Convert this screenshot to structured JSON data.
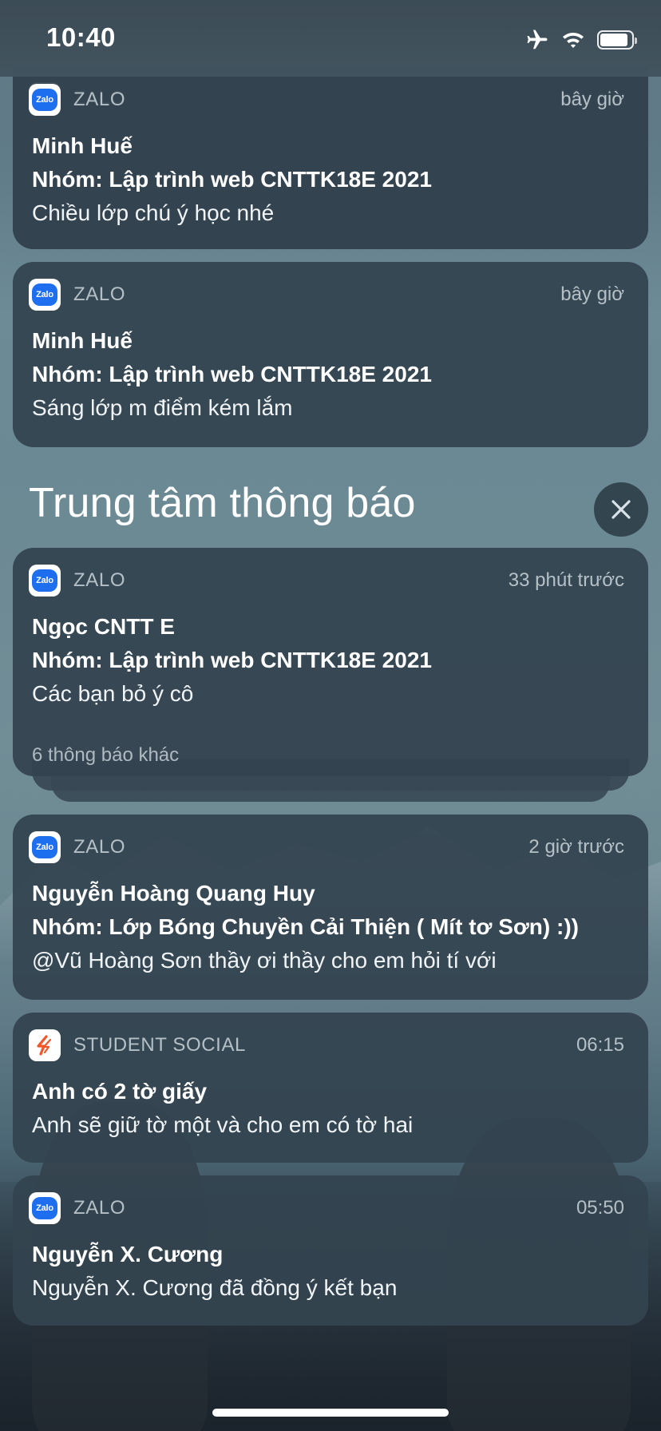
{
  "status_bar": {
    "time": "10:40",
    "icons": [
      "airplane-icon",
      "wifi-icon",
      "battery-icon"
    ],
    "battery_level": 0.9
  },
  "section": {
    "title": "Trung tâm thông báo",
    "close_icon": "close-icon"
  },
  "notifications": [
    {
      "app": "ZALO",
      "icon": "zalo-icon",
      "time": "bây giờ",
      "title": "Minh Huế",
      "subtitle": "Nhóm: Lập trình web CNTTK18E 2021",
      "message": "Chiều lớp chú ý học nhé"
    },
    {
      "app": "ZALO",
      "icon": "zalo-icon",
      "time": "bây giờ",
      "title": "Minh Huế",
      "subtitle": "Nhóm: Lập trình web CNTTK18E 2021",
      "message": "Sáng lớp m điểm kém lắm"
    },
    {
      "app": "ZALO",
      "icon": "zalo-icon",
      "time": "33 phút trước",
      "title": "Ngọc CNTT E",
      "subtitle": "Nhóm: Lập trình web CNTTK18E 2021",
      "message": "Các bạn bỏ ý cô",
      "more": "6 thông báo khác"
    },
    {
      "app": "ZALO",
      "icon": "zalo-icon",
      "time": "2 giờ trước",
      "title": "Nguyễn Hoàng Quang Huy",
      "subtitle": "Nhóm: Lớp Bóng Chuyền Cải Thiện ( Mít tơ Sơn) :))",
      "message": "@Vũ Hoàng Sơn thầy ơi thầy cho em hỏi tí với"
    },
    {
      "app": "STUDENT SOCIAL",
      "icon": "student-social-icon",
      "time": "06:15",
      "title": "Anh có 2 tờ giấy",
      "message": "Anh sẽ giữ tờ một và cho em có tờ hai"
    },
    {
      "app": "ZALO",
      "icon": "zalo-icon",
      "time": "05:50",
      "title": "Nguyễn X. Cương",
      "message": "Nguyễn X. Cương đã đồng ý kết bạn"
    }
  ],
  "zalo_icon_text": "Zalo"
}
